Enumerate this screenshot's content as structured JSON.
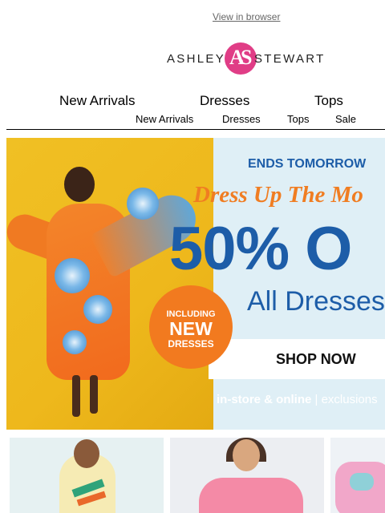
{
  "header": {
    "view_in_browser": "View in browser",
    "logo_word_left": "ASHLEY",
    "logo_word_right": "STEWART",
    "logo_monogram": "AS"
  },
  "nav_primary": [
    "New Arrivals",
    "Dresses",
    "Tops"
  ],
  "nav_secondary": [
    "New Arrivals",
    "Dresses",
    "Tops",
    "Sale"
  ],
  "hero": {
    "eyebrow": "ENDS TOMORROW",
    "script": "Dress Up The Mo",
    "headline": "50% O",
    "subhead": "All Dresses",
    "badge_line1": "INCLUDING",
    "badge_line2": "NEW",
    "badge_line3": "DRESSES",
    "cta": "SHOP NOW",
    "footer_bold": "in-store & online",
    "footer_rest": " | exclusions"
  },
  "colors": {
    "brand_pink": "#e03d86",
    "headline_blue": "#1d5da8",
    "accent_orange": "#f27a1f",
    "hero_bg": "#dfeff6"
  }
}
